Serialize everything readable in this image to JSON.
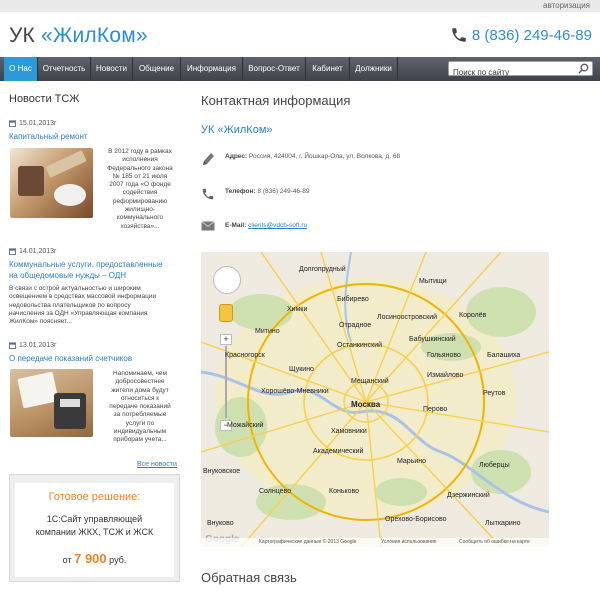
{
  "header": {
    "auth_link": "авторизация",
    "logo_prefix": "УК",
    "logo_brand": "«ЖилКом»",
    "phone": "8 (836) 249-46-89"
  },
  "nav": {
    "items": [
      {
        "label": "О Нас",
        "active": true
      },
      {
        "label": "Отчетность",
        "active": false
      },
      {
        "label": "Новости",
        "active": false
      },
      {
        "label": "Общение",
        "active": false
      },
      {
        "label": "Информация",
        "active": false
      },
      {
        "label": "Вопрос-Ответ",
        "active": false
      },
      {
        "label": "Кабинет",
        "active": false
      },
      {
        "label": "Должники",
        "active": false
      }
    ],
    "search_placeholder": "Поиск по сайту"
  },
  "news": {
    "title": "Новости ТСЖ",
    "items": [
      {
        "date": "15.01.2013г",
        "title": "Капитальный ремонт",
        "text_lines": [
          "В 2012 году в рамках",
          "исполнения",
          "Федерального закона",
          "№ 185 от 21 июля",
          "2007 года «О фонде",
          "содействия",
          "реформированию",
          "жилищно-",
          "коммунального",
          "хозяйства»..."
        ]
      },
      {
        "date": "14.01.2013г",
        "title_lines": [
          "Коммунальные услуги, предоставленные",
          "на общедомовые нужды – ОДН"
        ],
        "text_lines": [
          "В связи с острой актуальностью и широким",
          "освещением в средствах массовой информации",
          "недовольства плательщиков по вопросу",
          "начисления за ОДН «Управляющая компания",
          "ЖилКом» поясняет..."
        ]
      },
      {
        "date": "13.01.2013г",
        "title": "О передаче показаний счетчиков",
        "text_lines": [
          "Напоминаем, чем",
          "добросовестнее",
          "жители дома будут",
          "относиться к",
          "передаче показаний",
          "за потребляемые",
          "услуги по",
          "индивидуальным",
          "приборам учета..."
        ]
      }
    ],
    "all_news": "Все новости"
  },
  "promo": {
    "title": "Готовое решение:",
    "body_lines": [
      "1С:Сайт управляющей",
      "компании ЖКХ, ТСЖ и ЖСК"
    ],
    "price_prefix": "от",
    "price_amount": "7 900",
    "price_suffix": "руб."
  },
  "contacts": {
    "title": "Контактная информация",
    "company": "УК «ЖилКом»",
    "address_label": "Адрес:",
    "address": "Россия, 424004, г. Йошкар-Ола, ул. Волкова, д. 68",
    "phone_label": "Телефон:",
    "phone": "8 (836) 249-46-89",
    "email_label": "E-Mail:",
    "email": "clients@vdcb-soft.ru"
  },
  "map": {
    "labels": [
      "Долгопрудный",
      "Мытищи",
      "Химки",
      "Бибирево",
      "Отрадное",
      "Королёв",
      "Митино",
      "Лосиноостровский",
      "Останкинский",
      "Бабушкинский",
      "Гольяново",
      "Балашиха",
      "Красногорск",
      "Щукино",
      "Мещанский",
      "Измайлово",
      "Хорошёво-Мневники",
      "Москва",
      "Перово",
      "Реутов",
      "Можайский",
      "Хамовники",
      "Академический",
      "Люберцы",
      "Солнцево",
      "Коньково",
      "Орехово-Борисово",
      "Дзержинский",
      "Внуково",
      "Лыткарино",
      "Марьино",
      "Внуковское"
    ],
    "footer_data": "Картографические данные © 2013 Google",
    "footer_terms": "Условия использования",
    "footer_report": "Сообщить об ошибке на карте",
    "logo": "Google"
  },
  "feedback": {
    "title": "Обратная связь"
  },
  "colors": {
    "accent": "#2a8fd6",
    "nav_bg": "#4d535b",
    "nav_active": "#2c9ad9",
    "promo_orange": "#f08220"
  }
}
